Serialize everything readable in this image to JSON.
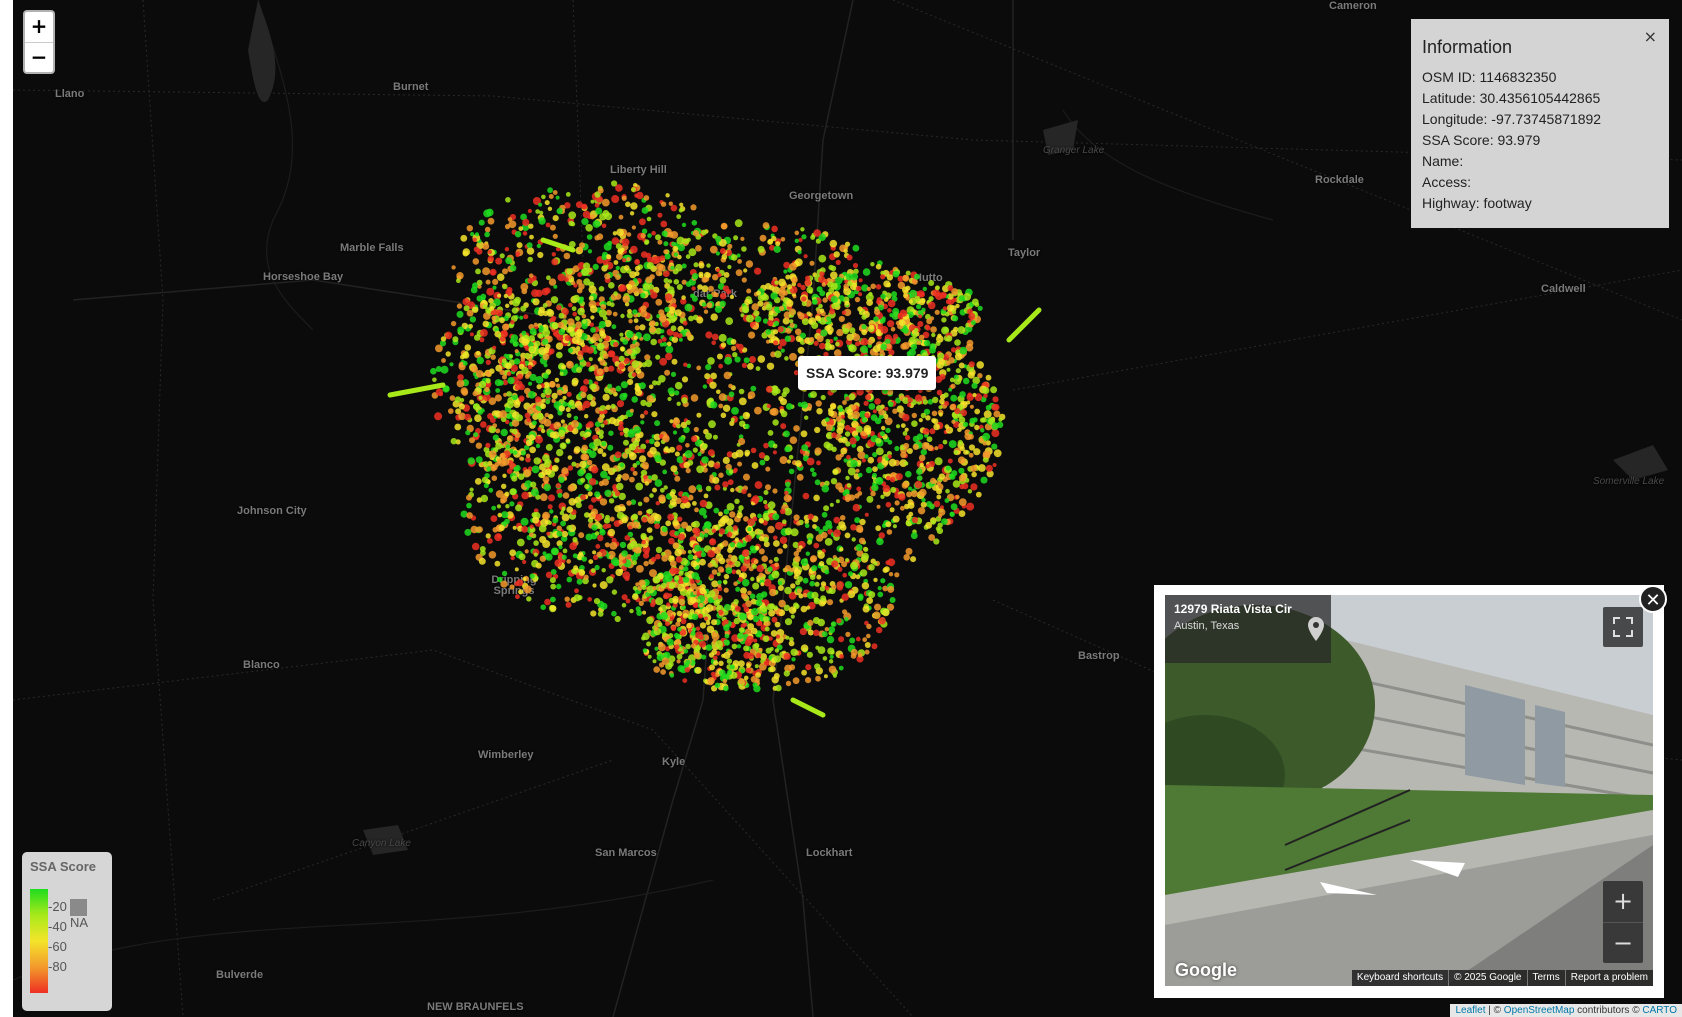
{
  "map": {
    "places": [
      "Cameron",
      "Llano",
      "Burnet",
      "Liberty Hill",
      "Georgetown",
      "Granger Lake",
      "Rockdale",
      "Marble Falls",
      "Horseshoe Bay",
      "Taylor",
      "Hutto",
      "Caldwell",
      "Johnson City",
      "Somerville Lake",
      "Dripping Springs",
      "Blanco",
      "Bastrop",
      "Wimberley",
      "Kyle",
      "Canyon Lake",
      "San Marcos",
      "Lockhart",
      "Bulverde",
      "NEW BRAUNFELS"
    ],
    "cedar_park": "dar Park"
  },
  "zoom": {
    "in": "+",
    "out": "−"
  },
  "info": {
    "title": "Information",
    "close": "×",
    "rows": [
      "OSM ID: 1146832350",
      "Latitude: 30.4356105442865",
      "Longitude: -97.73745871892",
      "SSA Score: 93.979",
      "Name:",
      "Access:",
      "Highway: footway"
    ]
  },
  "tooltip": "SSA Score: 93.979",
  "legend": {
    "title": "SSA Score",
    "ticks": [
      "20",
      "40",
      "60",
      "80"
    ],
    "na": "NA",
    "colors": [
      "#1fdc1f",
      "#a8e91a",
      "#f4e42a",
      "#f39a2c",
      "#ee3023"
    ]
  },
  "streetview": {
    "address": "12979 Riata Vista Cir",
    "city": "Austin, Texas",
    "logo": "Google",
    "footer": [
      "Keyboard shortcuts",
      "© 2025 Google",
      "Terms",
      "Report a problem"
    ],
    "zoom_in": "+",
    "zoom_out": "−",
    "close": "✕"
  },
  "attribution": {
    "leaflet": "Leaflet",
    "sep": " | © ",
    "osm": "OpenStreetMap",
    "contrib": " contributors © ",
    "carto": "CARTO"
  }
}
